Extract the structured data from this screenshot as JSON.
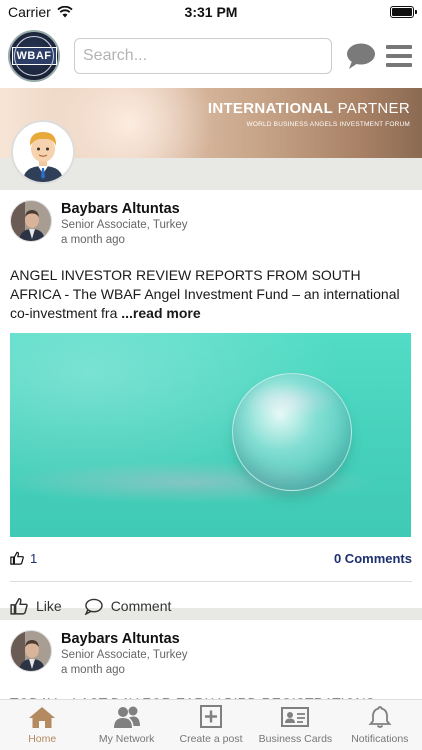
{
  "status_bar": {
    "carrier": "Carrier",
    "time": "3:31 PM"
  },
  "header": {
    "logo_text": "WBAF",
    "search_placeholder": "Search..."
  },
  "banner": {
    "title_bold": "INTERNATIONAL",
    "title_thin": " PARTNER",
    "subtitle": "WORLD BUSINESS ANGELS INVESTMENT FORUM"
  },
  "posts": [
    {
      "author": "Baybars Altuntas",
      "role": "Senior Associate, Turkey",
      "time": "a month ago",
      "text": "ANGEL INVESTOR REVIEW REPORTS FROM SOUTH AFRICA - The WBAF Angel Investment Fund – an international co-investment fra ",
      "read_more": "...read more",
      "likes": "1",
      "comments": "0 Comments",
      "like_label": "Like",
      "comment_label": "Comment"
    },
    {
      "author": "Baybars Altuntas",
      "role": "Senior Associate, Turkey",
      "time": "a month ago",
      "text": "TODAY – LAST DAY FOR EARLY BIRD REGISTRATIONS -"
    }
  ],
  "tabs": [
    {
      "label": "Home",
      "icon": "home-icon",
      "active": true
    },
    {
      "label": "My Network",
      "icon": "people-icon",
      "active": false
    },
    {
      "label": "Create a post",
      "icon": "plus-square-icon",
      "active": false
    },
    {
      "label": "Business Cards",
      "icon": "id-card-icon",
      "active": false
    },
    {
      "label": "Notifications",
      "icon": "bell-icon",
      "active": false
    }
  ],
  "colors": {
    "active_tab": "#b48a60",
    "link_blue": "#1d2f6f",
    "image_teal": "#4fd6c1"
  }
}
